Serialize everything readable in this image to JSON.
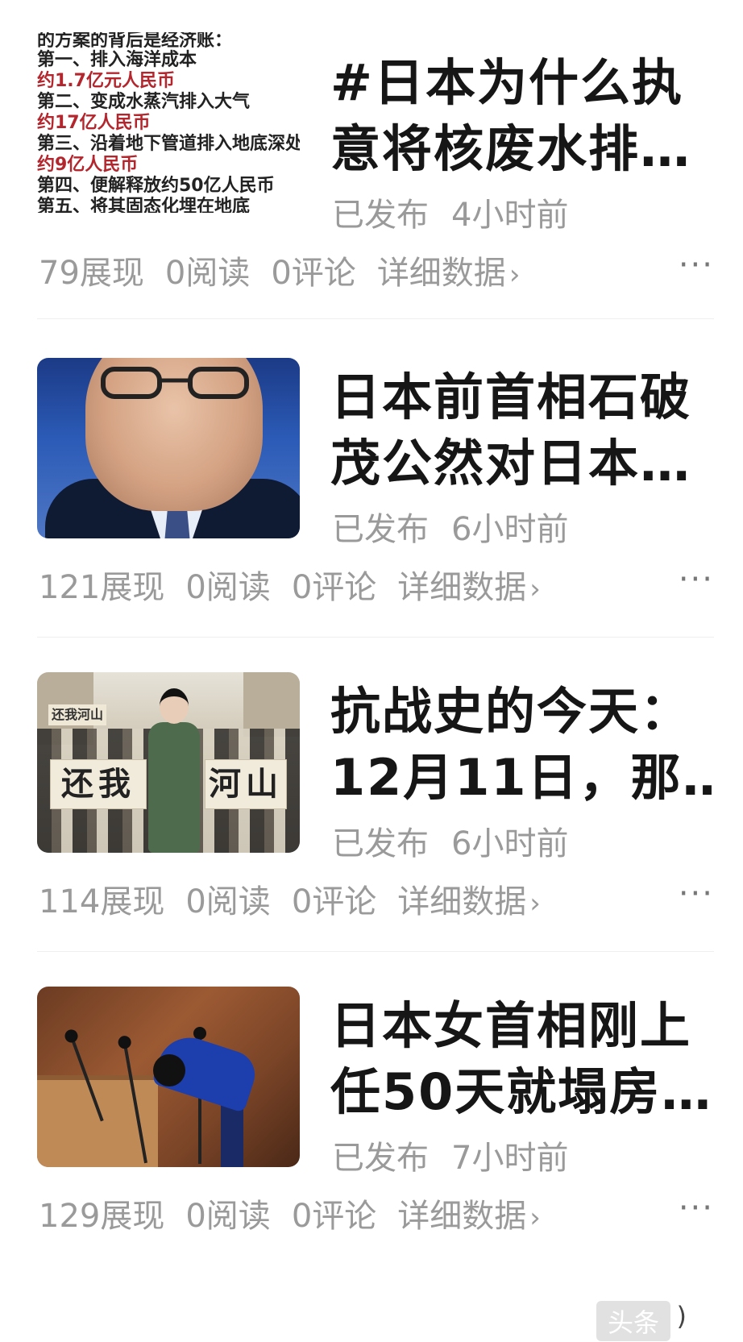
{
  "articles": [
    {
      "title_line1": "#日本为什么执",
      "title_line2": "意将核废水排…",
      "status": "已发布",
      "time": "4小时前",
      "views": "79展现",
      "reads": "0阅读",
      "comments": "0评论",
      "detail": "详细数据",
      "more": "···",
      "thumb_lines": [
        {
          "text": "的方案的背后是经济账：",
          "color": "black"
        },
        {
          "text": "第一、排入海洋成本",
          "color": "black"
        },
        {
          "text": "约1.7亿元人民币",
          "color": "red"
        },
        {
          "text": "第二、变成水蒸汽排入大气",
          "color": "black"
        },
        {
          "text": "约17亿人民币",
          "color": "red"
        },
        {
          "text": "第三、沿着地下管道排入地底深处",
          "color": "black"
        },
        {
          "text": "约9亿人民币",
          "color": "red"
        },
        {
          "text": "第四、便解释放约50亿人民币",
          "color": "black"
        },
        {
          "text": "第五、将其固态化埋在地底",
          "color": "black"
        }
      ]
    },
    {
      "title_line1": "日本前首相石破",
      "title_line2": "茂公然对日本…",
      "status": "已发布",
      "time": "6小时前",
      "views": "121展现",
      "reads": "0阅读",
      "comments": "0评论",
      "detail": "详细数据",
      "more": "···"
    },
    {
      "title_line1": "抗战史的今天：",
      "title_line2": "12月11日，那…",
      "status": "已发布",
      "time": "6小时前",
      "views": "114展现",
      "reads": "0阅读",
      "comments": "0评论",
      "detail": "详细数据",
      "more": "···",
      "banner_left": "还我",
      "banner_right": "河山",
      "sign": "还我河山"
    },
    {
      "title_line1": "日本女首相刚上",
      "title_line2": "任50天就塌房…",
      "status": "已发布",
      "time": "7小时前",
      "views": "129展现",
      "reads": "0阅读",
      "comments": "0评论",
      "detail": "详细数据",
      "more": "···"
    }
  ],
  "chevron": "›",
  "watermark": "头条",
  "watermark_tail": ")"
}
